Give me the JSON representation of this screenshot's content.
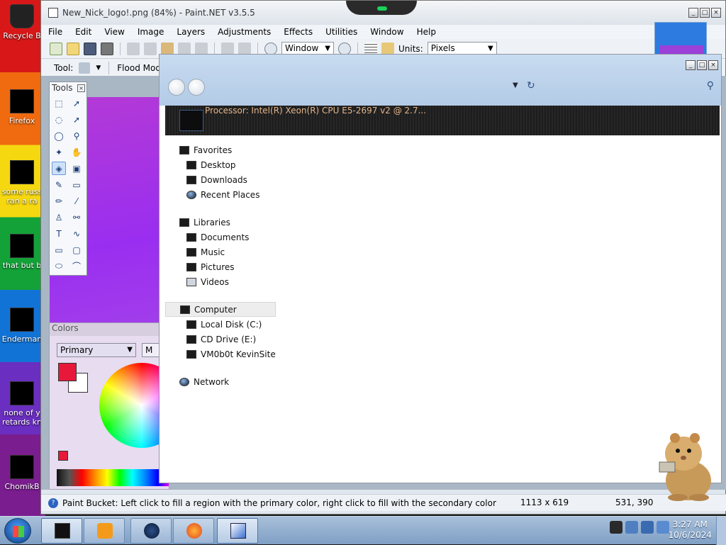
{
  "desktop": {
    "icons": [
      {
        "label": "Recycle B"
      },
      {
        "label": "Firefox"
      },
      {
        "label": "some russ ran a ra"
      },
      {
        "label": "that but b"
      },
      {
        "label": "Enderman"
      },
      {
        "label": "none of y retards kn"
      },
      {
        "label": "ChomikB"
      }
    ]
  },
  "paintnet": {
    "title": "New_Nick_logo!.png (84%) - Paint.NET v3.5.5",
    "menu": [
      "File",
      "Edit",
      "View",
      "Image",
      "Layers",
      "Adjustments",
      "Effects",
      "Utilities",
      "Window",
      "Help"
    ],
    "zoom_select": "Window",
    "units_label": "Units:",
    "units_select": "Pixels",
    "tool_label": "Tool:",
    "flood_mode_label": "Flood Mode:",
    "tools_title": "Tools",
    "colors_title": "Colors",
    "primary_select": "Primary",
    "more_button": "M",
    "status_text": "Paint Bucket: Left click to fill a region with the primary color, right click to fill with the secondary color",
    "image_size": "1113 x 619",
    "cursor_pos": "531, 390",
    "colors": {
      "primary": "#e8183a",
      "secondary": "#ffffff",
      "canvas": "#a33ee0"
    }
  },
  "explorer": {
    "processor_text": "Processor: Intel(R) Xeon(R) CPU E5-2697 v2 @ 2.7...",
    "favorites": {
      "label": "Favorites",
      "items": [
        "Desktop",
        "Downloads",
        "Recent Places"
      ]
    },
    "libraries": {
      "label": "Libraries",
      "items": [
        "Documents",
        "Music",
        "Pictures",
        "Videos"
      ]
    },
    "computer": {
      "label": "Computer",
      "items": [
        "Local Disk (C:)",
        "CD Drive (E:)",
        "VM0b0t KevinSite"
      ]
    },
    "network": {
      "label": "Network"
    }
  },
  "taskbar": {
    "time": "3:27 AM",
    "date": "10/6/2024"
  }
}
